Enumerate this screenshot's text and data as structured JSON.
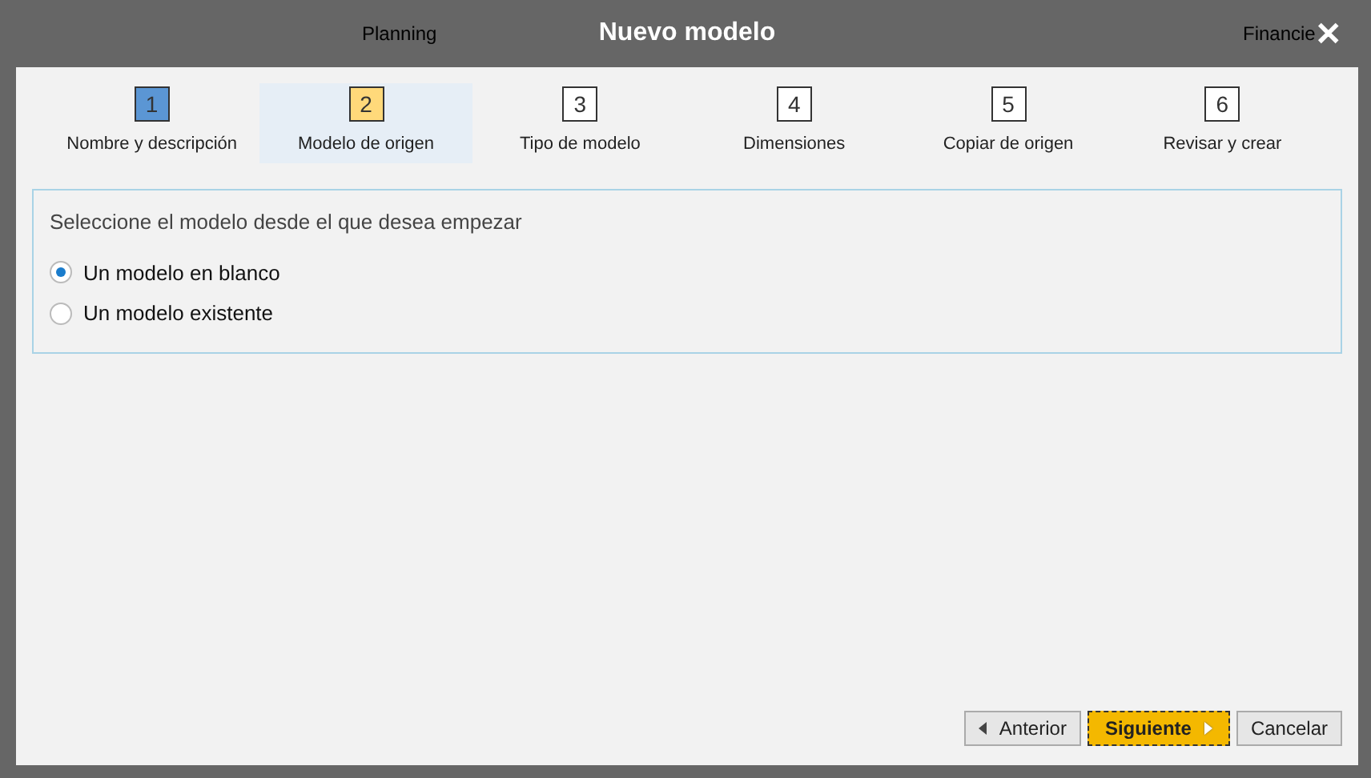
{
  "background": {
    "texts": [
      "Planning",
      "Financie"
    ]
  },
  "dialog": {
    "title": "Nuevo modelo",
    "close": "✕"
  },
  "steps": [
    {
      "number": "1",
      "label": "Nombre y descripción",
      "kind": "done",
      "selected": false
    },
    {
      "number": "2",
      "label": "Modelo de origen",
      "kind": "current",
      "selected": true
    },
    {
      "number": "3",
      "label": "Tipo de modelo",
      "kind": "todo",
      "selected": false
    },
    {
      "number": "4",
      "label": "Dimensiones",
      "kind": "todo",
      "selected": false
    },
    {
      "number": "5",
      "label": "Copiar de origen",
      "kind": "todo",
      "selected": false
    },
    {
      "number": "6",
      "label": "Revisar y crear",
      "kind": "todo",
      "selected": false
    }
  ],
  "panel": {
    "prompt": "Seleccione el modelo desde el que desea empezar",
    "options": [
      {
        "label": "Un modelo en blanco",
        "selected": true
      },
      {
        "label": "Un modelo existente",
        "selected": false
      }
    ]
  },
  "buttons": [
    {
      "kind": "back",
      "label": "Anterior"
    },
    {
      "kind": "primary",
      "label": "Siguiente"
    },
    {
      "kind": "plain",
      "label": "Cancelar"
    }
  ]
}
